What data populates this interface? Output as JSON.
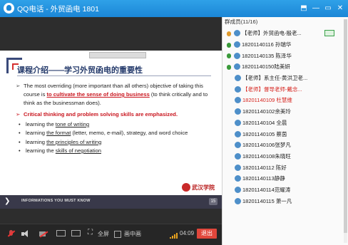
{
  "window": {
    "title": "QQ电话 - 外贸函电 1801",
    "buttons": [
      "⬒",
      "—",
      "▭",
      "✕"
    ]
  },
  "slide": {
    "title": "课程介绍——学习外贸函电的重要性",
    "objective_pre": "The most overriding (more important than all others) objective of taking this course is ",
    "objective_highlight": "to cultivate the sense of doing business",
    "objective_post": " (to think critically and to think as the businessman does).",
    "critical_head": "Critical thinking and problem solving skills are emphasized.",
    "bullets": [
      {
        "pre": "learning the ",
        "u": "tone of writing",
        "post": ""
      },
      {
        "pre": "learning ",
        "u": "the format",
        "post": " (letter, memo, e-mail), strategy, and word choice"
      },
      {
        "pre": "learning ",
        "u": "the principles of writing",
        "post": ""
      },
      {
        "pre": "learning the ",
        "u": "skills of negotiation",
        "post": ""
      }
    ],
    "logo_text": "武汉学院",
    "footer_text": "INFORMATIONS YOU MUST KNOW",
    "page_number": "15"
  },
  "controls": {
    "fullscreen_label": "全屏",
    "pip_label": "画中画",
    "timer": "04:09",
    "exit_label": "退出"
  },
  "panel": {
    "header": "群成员(11/16)",
    "members": [
      {
        "name": "【老师】外贸函电-殷老..."
      },
      {
        "name": "18201140116  孙瑞华"
      },
      {
        "name": "18201140135  陈泽华"
      },
      {
        "name": "18201140150陆美妍"
      },
      {
        "name": "【老师】系主任-黄洪卫老..."
      },
      {
        "name": "【老师】督导老师-戴念..."
      },
      {
        "name": "18201140109 杜慧维"
      },
      {
        "name": "18201140102余美玲"
      },
      {
        "name": "18201140104  全晨"
      },
      {
        "name": "18201140105  蔡茵"
      },
      {
        "name": "18201140106张梦凡"
      },
      {
        "name": "18201140108朱晓旺"
      },
      {
        "name": "18201140112 陈好"
      },
      {
        "name": "18201140113静静"
      },
      {
        "name": "18201140114范耀涛"
      },
      {
        "name": "18201140115  萧一凡"
      }
    ]
  }
}
